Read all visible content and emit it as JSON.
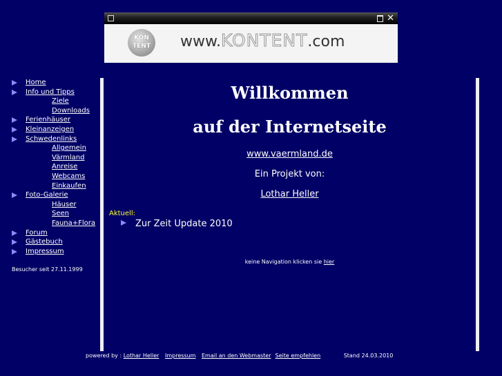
{
  "banner": {
    "logo_text_top": "KON",
    "logo_text_bottom": "TENT",
    "www_prefix": "www.",
    "brand": "KONTENT",
    "www_suffix": ".com",
    "close_symbol": "✕"
  },
  "sidebar": {
    "items": [
      {
        "label": "Home",
        "level": 1
      },
      {
        "label": "Info und Tipps",
        "level": 1
      },
      {
        "label": "Ziele",
        "level": 2
      },
      {
        "label": "Downloads",
        "level": 2
      },
      {
        "label": "Ferienhäuser",
        "level": 1
      },
      {
        "label": "Kleinanzeigen",
        "level": 1
      },
      {
        "label": "Schwedenlinks",
        "level": 1
      },
      {
        "label": "Allgemein",
        "level": 2
      },
      {
        "label": "Värmland",
        "level": 2
      },
      {
        "label": "Anreise",
        "level": 2
      },
      {
        "label": "Webcams",
        "level": 2
      },
      {
        "label": "Einkaufen",
        "level": 2
      },
      {
        "label": "Foto-Galerie",
        "level": 1
      },
      {
        "label": "Häuser",
        "level": 2
      },
      {
        "label": "Seen",
        "level": 2
      },
      {
        "label": "Fauna+Flora",
        "level": 2
      },
      {
        "label": "Forum",
        "level": 1
      },
      {
        "label": "Gästebuch",
        "level": 1
      },
      {
        "label": "Impressum",
        "level": 1
      }
    ],
    "visitors": "Besucher seit 27.11.1999"
  },
  "main": {
    "title_line1": "Willkommen",
    "title_line2": "auf der Internetseite",
    "site_link": "www.vaermland.de",
    "project_label": "Ein Projekt von:",
    "author_link": "Lothar Heller",
    "aktuell_label": "Aktuell:",
    "news_item": "Zur Zeit Update 2010",
    "nonav_text": "keine Navigation klicken sie ",
    "nonav_link": "hier"
  },
  "footer": {
    "powered_by": "powered by : ",
    "author_link": "Lothar Heller",
    "impressum_link": "Impressum",
    "email_link": "Email an den Webmaster",
    "recommend_link": "Seite empfehlen",
    "stand": "Stand 24.03.2010"
  },
  "colors": {
    "background": "#000066",
    "bullet": "#8a8aff",
    "aktuell": "#ffff33"
  }
}
